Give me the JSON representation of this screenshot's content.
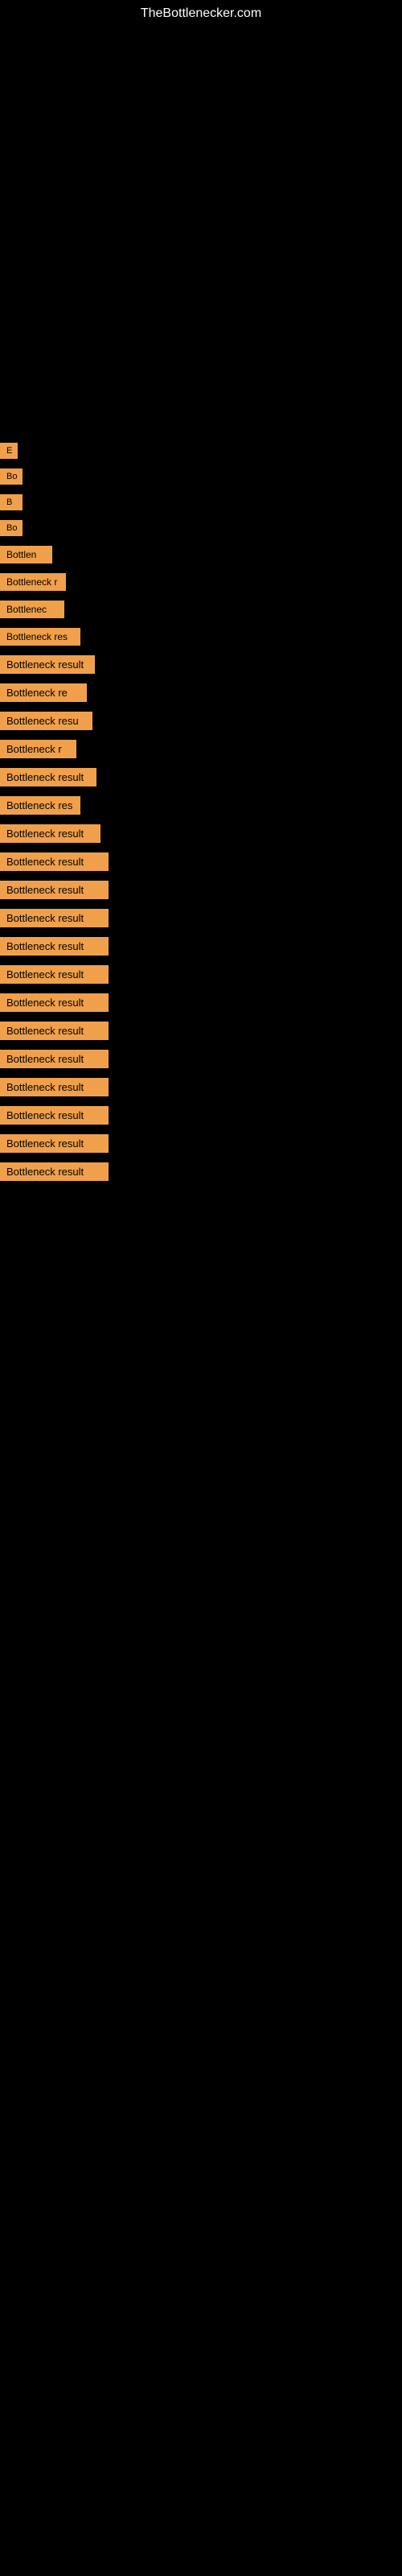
{
  "site": {
    "title": "TheBottlenecker.com"
  },
  "items": [
    {
      "label": "E",
      "index": 0
    },
    {
      "label": "Bo",
      "index": 1
    },
    {
      "label": "B",
      "index": 2
    },
    {
      "label": "Bo",
      "index": 3
    },
    {
      "label": "Bottlen",
      "index": 4
    },
    {
      "label": "Bottleneck r",
      "index": 5
    },
    {
      "label": "Bottlenec",
      "index": 6
    },
    {
      "label": "Bottleneck res",
      "index": 7
    },
    {
      "label": "Bottleneck result",
      "index": 8
    },
    {
      "label": "Bottleneck re",
      "index": 9
    },
    {
      "label": "Bottleneck resu",
      "index": 10
    },
    {
      "label": "Bottleneck r",
      "index": 11
    },
    {
      "label": "Bottleneck result",
      "index": 12
    },
    {
      "label": "Bottleneck res",
      "index": 13
    },
    {
      "label": "Bottleneck result",
      "index": 14
    },
    {
      "label": "Bottleneck result",
      "index": 15
    },
    {
      "label": "Bottleneck result",
      "index": 16
    },
    {
      "label": "Bottleneck result",
      "index": 17
    },
    {
      "label": "Bottleneck result",
      "index": 18
    },
    {
      "label": "Bottleneck result",
      "index": 19
    },
    {
      "label": "Bottleneck result",
      "index": 20
    },
    {
      "label": "Bottleneck result",
      "index": 21
    },
    {
      "label": "Bottleneck result",
      "index": 22
    },
    {
      "label": "Bottleneck result",
      "index": 23
    },
    {
      "label": "Bottleneck result",
      "index": 24
    },
    {
      "label": "Bottleneck result",
      "index": 25
    },
    {
      "label": "Bottleneck result",
      "index": 26
    }
  ]
}
